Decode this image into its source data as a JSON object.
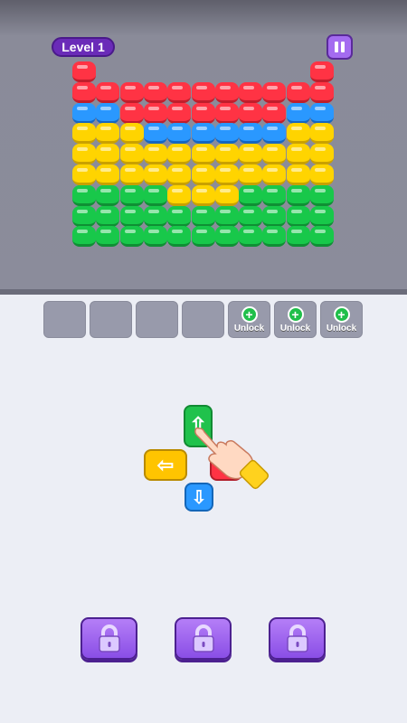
{
  "header": {
    "level_label": "Level 1",
    "pause_icon": "pause-icon"
  },
  "board": {
    "colors": {
      "R": "#ff3344",
      "B": "#2a98ff",
      "Y": "#ffd400",
      "G": "#18c84a"
    },
    "rows": [
      "R.........R",
      "RRRRRRRRRRR",
      "BBRRRRRRRBB",
      "YYYBBBBBBYY",
      "YYYYYYYYYYY",
      "YYYYYYYYYYY",
      "GGGGYYYGGGG",
      "GGGGGGGGGGG",
      "GGGGGGGGGGG"
    ]
  },
  "slots": [
    {
      "locked": false
    },
    {
      "locked": false
    },
    {
      "locked": false
    },
    {
      "locked": false
    },
    {
      "locked": true,
      "label": "Unlock"
    },
    {
      "locked": true,
      "label": "Unlock"
    },
    {
      "locked": true,
      "label": "Unlock"
    }
  ],
  "arrow_blocks": [
    {
      "color": "#20c24c",
      "direction": "up",
      "glyph": "⇧"
    },
    {
      "color": "#ffc400",
      "direction": "left",
      "glyph": "⇦"
    },
    {
      "color": "#ff3344",
      "direction": "right",
      "glyph": ""
    },
    {
      "color": "#2a98ff",
      "direction": "down",
      "glyph": "⇩"
    }
  ],
  "lock_buttons": [
    {
      "icon": "padlock-icon"
    },
    {
      "icon": "padlock-icon"
    },
    {
      "icon": "padlock-icon"
    }
  ]
}
